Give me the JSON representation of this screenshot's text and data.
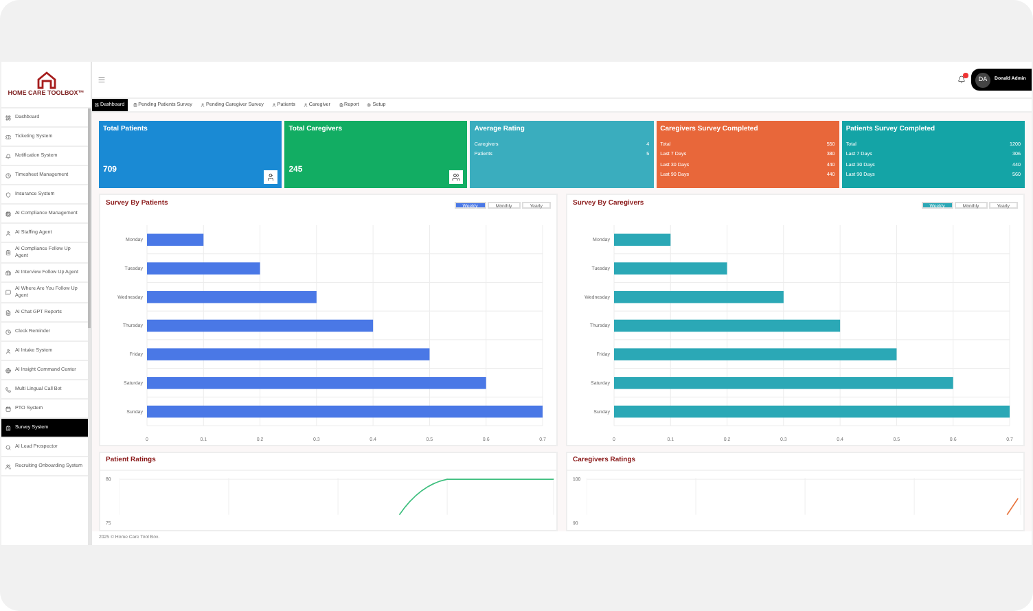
{
  "brand": {
    "name": "HOME CARE TOOLBOX™"
  },
  "sidebar": {
    "items": [
      {
        "label": "Dashboard",
        "selected": false
      },
      {
        "label": "Ticketing System",
        "selected": false
      },
      {
        "label": "Notification System",
        "selected": false
      },
      {
        "label": "Timesheet Management",
        "selected": false
      },
      {
        "label": "Insurance System",
        "selected": false
      },
      {
        "label": "AI Compliance Management",
        "selected": false
      },
      {
        "label": "AI Staffing Agent",
        "selected": false
      },
      {
        "label": "AI Compliance Follow Up Agent",
        "selected": false
      },
      {
        "label": "AI Interview Follow Up Agent",
        "selected": false
      },
      {
        "label": "AI Where Are You Follow Up Agent",
        "selected": false
      },
      {
        "label": "AI Chat GPT Reports",
        "selected": false
      },
      {
        "label": "Clock Reminder",
        "selected": false
      },
      {
        "label": "AI Intake System",
        "selected": false
      },
      {
        "label": "AI Insight Command Center",
        "selected": false
      },
      {
        "label": "Multi Lingual Call Bot",
        "selected": false
      },
      {
        "label": "PTO System",
        "selected": false
      },
      {
        "label": "Survey System",
        "selected": true
      },
      {
        "label": "AI Lead Prospector",
        "selected": false
      },
      {
        "label": "Recruiting Onboarding System",
        "selected": false
      }
    ]
  },
  "header": {
    "user": {
      "initials": "DA",
      "name": "Donald Admin"
    },
    "notification_dot": true
  },
  "tabs": [
    {
      "label": "Dashboard",
      "selected": true
    },
    {
      "label": "Pending Patients Survey",
      "selected": false
    },
    {
      "label": "Pending Caregiver Survey",
      "selected": false
    },
    {
      "label": "Patients",
      "selected": false
    },
    {
      "label": "Caregiver",
      "selected": false
    },
    {
      "label": "Report",
      "selected": false
    },
    {
      "label": "Setup",
      "selected": false
    }
  ],
  "cards": [
    {
      "kind": "count",
      "title": "Total Patients",
      "value": "709",
      "color": "#1a8ad4"
    },
    {
      "kind": "count",
      "title": "Total Caregivers",
      "value": "245",
      "color": "#12ad63"
    },
    {
      "kind": "breakdown",
      "title": "Average Rating",
      "color": "#3aadbe",
      "rows": [
        {
          "label": "Caregivers",
          "value": "4"
        },
        {
          "label": "Patients",
          "value": "5"
        }
      ]
    },
    {
      "kind": "breakdown",
      "title": "Caregivers Survey Completed",
      "color": "#e8673a",
      "rows": [
        {
          "label": "Total",
          "value": "550"
        },
        {
          "label": "Last 7 Days",
          "value": "380"
        },
        {
          "label": "Last 30 Days",
          "value": "440"
        },
        {
          "label": "Last 90 Days",
          "value": "440"
        }
      ]
    },
    {
      "kind": "breakdown",
      "title": "Patients Survey Completed",
      "color": "#14a4a6",
      "rows": [
        {
          "label": "Total",
          "value": "1200"
        },
        {
          "label": "Last 7 Days",
          "value": "306"
        },
        {
          "label": "Last 30 Days",
          "value": "440"
        },
        {
          "label": "Last 90 Days",
          "value": "560"
        }
      ]
    }
  ],
  "survey_charts": [
    {
      "title": "Survey By Patients",
      "periods": [
        {
          "label": "Weekly",
          "selected": true
        },
        {
          "label": "Monthly",
          "selected": false
        },
        {
          "label": "Yearly",
          "selected": false
        }
      ],
      "chart_data": {
        "type": "bar",
        "orientation": "horizontal",
        "categories": [
          "Monday",
          "Tuesday",
          "Wednesday",
          "Thursday",
          "Friday",
          "Saturday",
          "Sunday"
        ],
        "series": [
          {
            "color": "#4a78e6",
            "values": [
              0.1,
              0.2,
              0.3,
              0.4,
              0.5,
              0.6,
              0.7
            ]
          }
        ],
        "xlim": [
          0,
          0.7
        ],
        "xticks": [
          0,
          0.1,
          0.2,
          0.3,
          0.4,
          0.5,
          0.6,
          0.7
        ],
        "grid": true
      }
    },
    {
      "title": "Survey By Caregivers",
      "periods": [
        {
          "label": "Weekly",
          "selected": true
        },
        {
          "label": "Monthly",
          "selected": false
        },
        {
          "label": "Yearly",
          "selected": false
        }
      ],
      "chart_data": {
        "type": "bar",
        "orientation": "horizontal",
        "categories": [
          "Monday",
          "Tuesday",
          "Wednesday",
          "Thursday",
          "Friday",
          "Saturday",
          "Sunday"
        ],
        "series": [
          {
            "color": "#2ba8b6",
            "values": [
              0.1,
              0.2,
              0.3,
              0.4,
              0.5,
              0.6,
              0.7
            ]
          }
        ],
        "xlim": [
          0,
          0.7
        ],
        "xticks": [
          0,
          0.1,
          0.2,
          0.3,
          0.4,
          0.5,
          0.6,
          0.7
        ],
        "grid": true
      }
    }
  ],
  "rating_charts": [
    {
      "title": "Patient Ratings",
      "color": "#3fbf7f",
      "tick_labels": [
        "80",
        "75"
      ]
    },
    {
      "title": "Caregivers Ratings",
      "color": "#e8733a",
      "tick_labels": [
        "100",
        "90"
      ]
    }
  ],
  "footer": {
    "text": "2025 © Home Care Tool Box."
  }
}
